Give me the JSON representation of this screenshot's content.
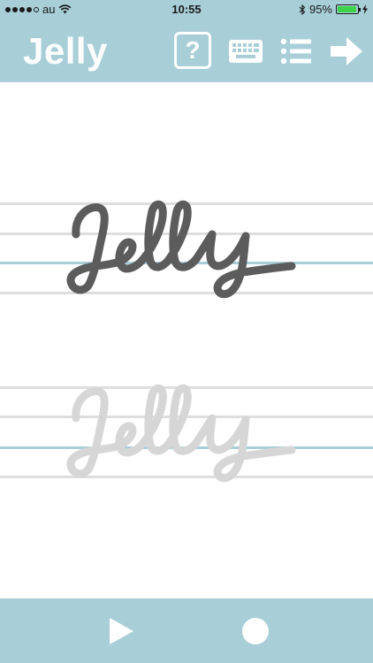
{
  "status_bar": {
    "carrier": "au",
    "time": "10:55",
    "battery_percent": "95%",
    "battery_level": 0.95,
    "icons": [
      "signal-dots-icon",
      "wifi-icon",
      "bluetooth-icon",
      "battery-icon",
      "charging-bolt-icon"
    ]
  },
  "header": {
    "title": "Jelly",
    "help_label": "?",
    "buttons": [
      "help-icon",
      "keyboard-icon",
      "list-icon",
      "arrow-right-icon"
    ]
  },
  "practice": {
    "model_word": "Jelly",
    "trace_word": "Jelly",
    "colors": {
      "model_stroke": "#5c5c5c",
      "trace_stroke": "#d6d6d6",
      "guide_gray": "#dedede",
      "guide_blue": "#a8ced8"
    }
  },
  "footer": {
    "buttons": [
      "play-icon",
      "record-icon"
    ]
  },
  "theme": {
    "bar_color": "#a8ced8",
    "background": "#ffffff"
  }
}
